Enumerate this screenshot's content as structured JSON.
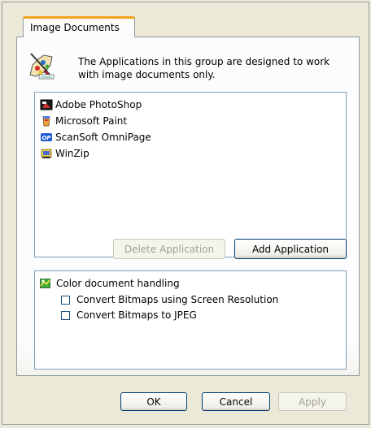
{
  "tab": {
    "label": "Image Documents"
  },
  "intro": {
    "text": "The Applications in this group are designed to work with image documents only."
  },
  "applications": [
    {
      "label": "Adobe PhotoShop",
      "icon": "photoshop-icon"
    },
    {
      "label": "Microsoft Paint",
      "icon": "paint-icon"
    },
    {
      "label": "ScanSoft OmniPage",
      "icon": "omnipage-icon"
    },
    {
      "label": "WinZip",
      "icon": "winzip-icon"
    }
  ],
  "buttons": {
    "delete_application": "Delete Application",
    "add_application": "Add Application",
    "ok": "OK",
    "cancel": "Cancel",
    "apply": "Apply"
  },
  "options": {
    "group_label": "Color document handling",
    "items": [
      {
        "label": "Convert Bitmaps using Screen Resolution",
        "checked": false
      },
      {
        "label": "Convert Bitmaps to JPEG",
        "checked": false
      }
    ]
  },
  "colors": {
    "dialog_bg": "#ece9d8",
    "tab_accent": "#f4a31c",
    "list_border": "#7f9db9",
    "button_border": "#003c74"
  }
}
